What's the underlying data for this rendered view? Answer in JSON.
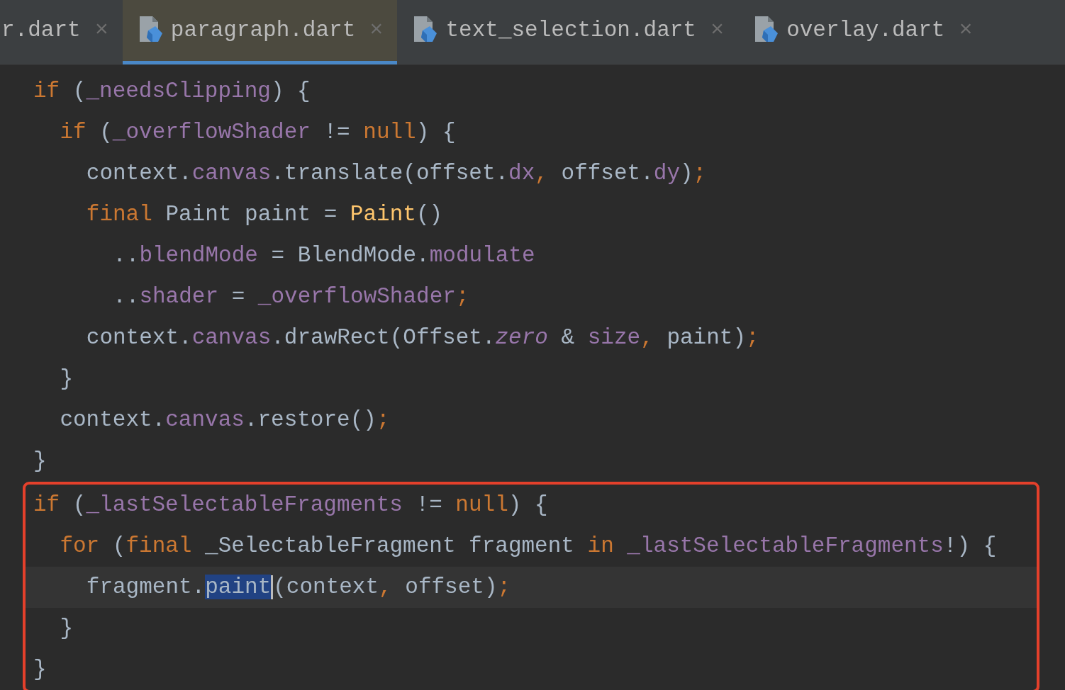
{
  "tabs": [
    {
      "label": "r.dart",
      "close": "×",
      "selected": false,
      "icon": false
    },
    {
      "label": "paragraph.dart",
      "close": "×",
      "selected": true,
      "icon": true
    },
    {
      "label": "text_selection.dart",
      "close": "×",
      "selected": false,
      "icon": true
    },
    {
      "label": "overlay.dart",
      "close": "×",
      "selected": false,
      "icon": true
    }
  ],
  "code_lines": [
    {
      "tokens": [
        {
          "kind": "keyword",
          "text": "if"
        },
        {
          "kind": "plain",
          "text": " ("
        },
        {
          "kind": "field",
          "text": "_needsClipping"
        },
        {
          "kind": "plain",
          "text": ") {"
        }
      ],
      "children": [
        {
          "tokens": [
            {
              "kind": "keyword",
              "text": "if"
            },
            {
              "kind": "plain",
              "text": " ("
            },
            {
              "kind": "field",
              "text": "_overflowShader"
            },
            {
              "kind": "plain",
              "text": " != "
            },
            {
              "kind": "keyword",
              "text": "null"
            },
            {
              "kind": "plain",
              "text": ") {"
            }
          ],
          "children": [
            {
              "tokens": [
                {
                  "kind": "plain",
                  "text": "context."
                },
                {
                  "kind": "field",
                  "text": "canvas"
                },
                {
                  "kind": "plain",
                  "text": ".translate(offset."
                },
                {
                  "kind": "field",
                  "text": "dx"
                },
                {
                  "kind": "keyword",
                  "text": ", "
                },
                {
                  "kind": "plain",
                  "text": "offset."
                },
                {
                  "kind": "field",
                  "text": "dy"
                },
                {
                  "kind": "plain",
                  "text": ")"
                },
                {
                  "kind": "keyword",
                  "text": ";"
                }
              ]
            },
            {
              "tokens": [
                {
                  "kind": "keyword",
                  "text": "final"
                },
                {
                  "kind": "plain",
                  "text": " Paint paint = "
                },
                {
                  "kind": "function",
                  "text": "Paint"
                },
                {
                  "kind": "plain",
                  "text": "()"
                }
              ],
              "children": [
                {
                  "tokens": [
                    {
                      "kind": "plain",
                      "text": ".."
                    },
                    {
                      "kind": "field",
                      "text": "blendMode"
                    },
                    {
                      "kind": "plain",
                      "text": " = BlendMode."
                    },
                    {
                      "kind": "field",
                      "text": "modulate"
                    }
                  ]
                },
                {
                  "tokens": [
                    {
                      "kind": "plain",
                      "text": ".."
                    },
                    {
                      "kind": "field",
                      "text": "shader"
                    },
                    {
                      "kind": "plain",
                      "text": " = "
                    },
                    {
                      "kind": "field",
                      "text": "_overflowShader"
                    },
                    {
                      "kind": "keyword",
                      "text": ";"
                    }
                  ]
                }
              ]
            },
            {
              "tokens": [
                {
                  "kind": "plain",
                  "text": "context."
                },
                {
                  "kind": "field",
                  "text": "canvas"
                },
                {
                  "kind": "plain",
                  "text": ".drawRect(Offset."
                },
                {
                  "kind": "static",
                  "text": "zero"
                },
                {
                  "kind": "plain",
                  "text": " & "
                },
                {
                  "kind": "field",
                  "text": "size"
                },
                {
                  "kind": "keyword",
                  "text": ", "
                },
                {
                  "kind": "plain",
                  "text": "paint)"
                },
                {
                  "kind": "keyword",
                  "text": ";"
                }
              ]
            }
          ]
        },
        {
          "tokens": [
            {
              "kind": "plain",
              "text": "}"
            }
          ]
        },
        {
          "tokens": [
            {
              "kind": "plain",
              "text": "context."
            },
            {
              "kind": "field",
              "text": "canvas"
            },
            {
              "kind": "plain",
              "text": ".restore()"
            },
            {
              "kind": "keyword",
              "text": ";"
            }
          ]
        }
      ]
    },
    {
      "tokens": [
        {
          "kind": "plain",
          "text": "}"
        }
      ]
    }
  ],
  "highlighted_block": {
    "lines": [
      {
        "tokens": [
          {
            "kind": "keyword",
            "text": "if"
          },
          {
            "kind": "plain",
            "text": " ("
          },
          {
            "kind": "field",
            "text": "_lastSelectableFragments"
          },
          {
            "kind": "plain",
            "text": " != "
          },
          {
            "kind": "keyword",
            "text": "null"
          },
          {
            "kind": "plain",
            "text": ") {"
          }
        ],
        "children": [
          {
            "tokens": [
              {
                "kind": "keyword",
                "text": "for"
              },
              {
                "kind": "plain",
                "text": " ("
              },
              {
                "kind": "keyword",
                "text": "final"
              },
              {
                "kind": "plain",
                "text": " _SelectableFragment fragment "
              },
              {
                "kind": "keyword",
                "text": "in"
              },
              {
                "kind": "field",
                "text": " _lastSelectableFragments"
              },
              {
                "kind": "plain",
                "text": "!) {"
              }
            ],
            "children": [
              {
                "tokens": [
                  {
                    "kind": "plain",
                    "text": "fragment."
                  },
                  {
                    "kind": "selected",
                    "text": "paint"
                  },
                  {
                    "kind": "caret"
                  },
                  {
                    "kind": "plain",
                    "text": "(context"
                  },
                  {
                    "kind": "keyword",
                    "text": ", "
                  },
                  {
                    "kind": "plain",
                    "text": "offset)"
                  },
                  {
                    "kind": "keyword",
                    "text": ";"
                  }
                ]
              }
            ]
          },
          {
            "tokens": [
              {
                "kind": "plain",
                "text": "}"
              }
            ]
          }
        ]
      },
      {
        "tokens": [
          {
            "kind": "plain",
            "text": "}"
          }
        ]
      }
    ]
  }
}
